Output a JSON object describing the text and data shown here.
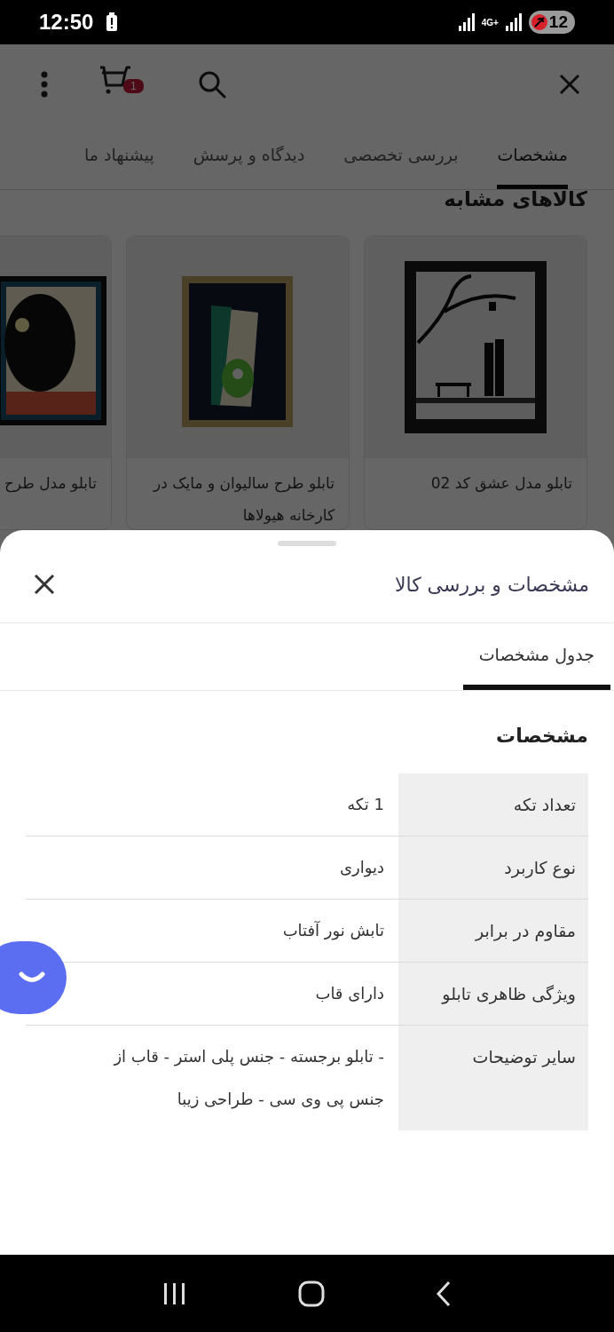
{
  "status_bar": {
    "time": "12:50",
    "network": "4G+",
    "battery": "12"
  },
  "toolbar": {
    "cart_count": "1"
  },
  "tabs": [
    {
      "label": "مشخصات",
      "selected": true
    },
    {
      "label": "بررسی تخصصی",
      "selected": false
    },
    {
      "label": "دیدگاه و پرسش",
      "selected": false
    },
    {
      "label": "پیشنهاد ما",
      "selected": false
    }
  ],
  "similar": {
    "title": "کالاهای مشابه",
    "products": [
      {
        "title": "تابلو مدل عشق کد 02",
        "kind": "picture"
      },
      {
        "title": "تابلو طرح سالیوان و مایک در کارخانه هیولاها",
        "kind": "picture"
      },
      {
        "title": "تابلو مدل طرح",
        "kind": "picture"
      }
    ]
  },
  "sheet": {
    "title": "مشخصات و بررسی کالا",
    "tabs": [
      {
        "label": "جدول مشخصات",
        "selected": true
      }
    ],
    "section_title": "مشخصات",
    "specs": [
      {
        "key": "تعداد تکه",
        "value": "1 تکه"
      },
      {
        "key": "نوع کاربرد",
        "value": "دیواری"
      },
      {
        "key": "مقاوم در برابر",
        "value": "تابش نور آفتاب"
      },
      {
        "key": "ویژگی ظاهری تابلو",
        "value": "دارای قاب"
      },
      {
        "key": "سایر توضیحات",
        "value": "- تابلو برجسته - جنس پلی استر - قاب از جنس پی وی سی - طراحی زیبا"
      }
    ]
  }
}
